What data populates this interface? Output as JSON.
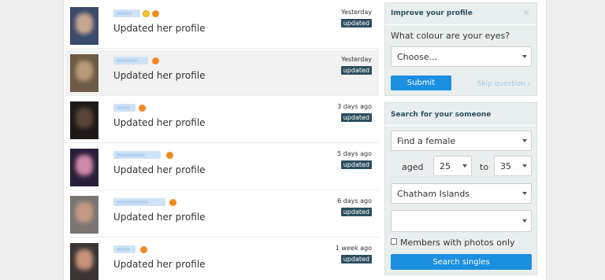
{
  "feed": {
    "items": [
      {
        "status": "Updated her profile",
        "time": "Yesterday",
        "badge": "updated",
        "highlighted": false,
        "verified": true
      },
      {
        "status": "Updated her profile",
        "time": "Yesterday",
        "badge": "updated",
        "highlighted": true,
        "verified": false
      },
      {
        "status": "Updated her profile",
        "time": "3 days ago",
        "badge": "updated",
        "highlighted": false,
        "verified": false
      },
      {
        "status": "Updated her profile",
        "time": "5 days ago",
        "badge": "updated",
        "highlighted": false,
        "verified": false
      },
      {
        "status": "Updated her profile",
        "time": "6 days ago",
        "badge": "updated",
        "highlighted": false,
        "verified": false
      },
      {
        "status": "Updated her profile",
        "time": "1 week ago",
        "badge": "updated",
        "highlighted": false,
        "verified": false
      }
    ]
  },
  "improve": {
    "title": "Improve your profile",
    "close_icon": "close-icon",
    "question": "What colour are your eyes?",
    "select_value": "Choose...",
    "submit_label": "Submit",
    "skip_label": "Skip question ›"
  },
  "search": {
    "title": "Search for your someone",
    "find_value": "Find a female",
    "aged_label": "aged",
    "age_from": "25",
    "to_label": "to",
    "age_to": "35",
    "location_value": "Chatham Islands",
    "region_value": "",
    "photos_label": "Members with photos only",
    "search_label": "Search singles"
  },
  "colors": {
    "accent": "#1b8fe0",
    "badge": "#2d4f5e",
    "online": "#f28a20",
    "card_bg": "#e8efee"
  }
}
